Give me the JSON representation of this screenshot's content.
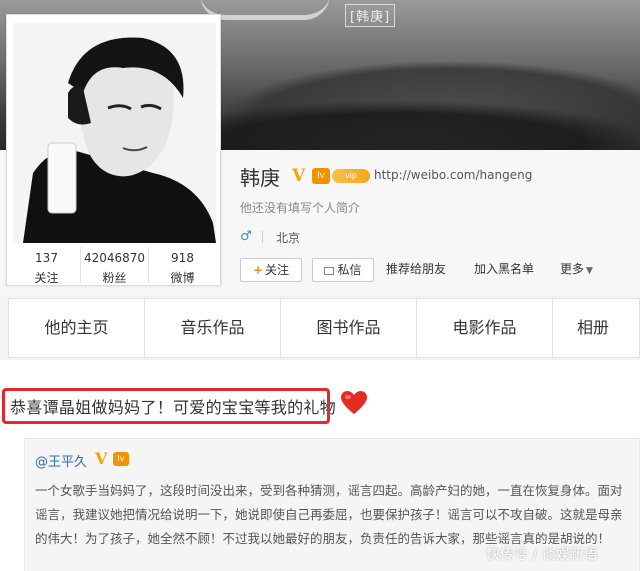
{
  "banner": {
    "signature_text": "[韩庚]",
    "colors": {
      "dark": "#2a2a2a",
      "light": "#9a9a9a"
    }
  },
  "profile": {
    "name": "韩庚",
    "verified_badge": "V",
    "level_icon_text": "lv",
    "vip_icon_text": "vip",
    "url": "http://weibo.com/hangeng",
    "bio": "他还没有填写个人简介",
    "gender_icon": "♂",
    "location": "北京"
  },
  "stats": [
    {
      "value": "137",
      "label": "关注"
    },
    {
      "value": "42046870",
      "label": "粉丝"
    },
    {
      "value": "918",
      "label": "微博"
    }
  ],
  "actions": {
    "follow": "关注",
    "follow_icon": "+",
    "message": "私信",
    "recommend": "推荐给朋友",
    "block": "加入黑名单",
    "more": "更多",
    "more_caret": "▼"
  },
  "tabs": [
    "他的主页",
    "音乐作品",
    "图书作品",
    "电影作品",
    "相册"
  ],
  "post": {
    "text": "恭喜谭晶姐做妈妈了！可爱的宝宝等我的礼物",
    "emoji": "heart-icon",
    "repost": {
      "author": "@王平久",
      "verified_badge": "V",
      "level_icon_text": "lv",
      "text": "一个女歌手当妈妈了，这段时间没出来，受到各种猜测，谣言四起。高龄产妇的她，一直在恢复身体。面对谣言，我建议她把情况给说明一下，她说即使自己再委屈，也要保护孩子！谣言可以不攻自破。这就是母亲的伟大！为了孩子，她全然不顾！不过我以她最好的朋友，负责任的告诉大家，那些谣言真的是胡说的！"
    }
  },
  "watermark": "快传号 / 谈娱新语",
  "colors": {
    "highlight": "#e8272c",
    "accent": "#f58d1e",
    "link": "#2b6db6"
  }
}
